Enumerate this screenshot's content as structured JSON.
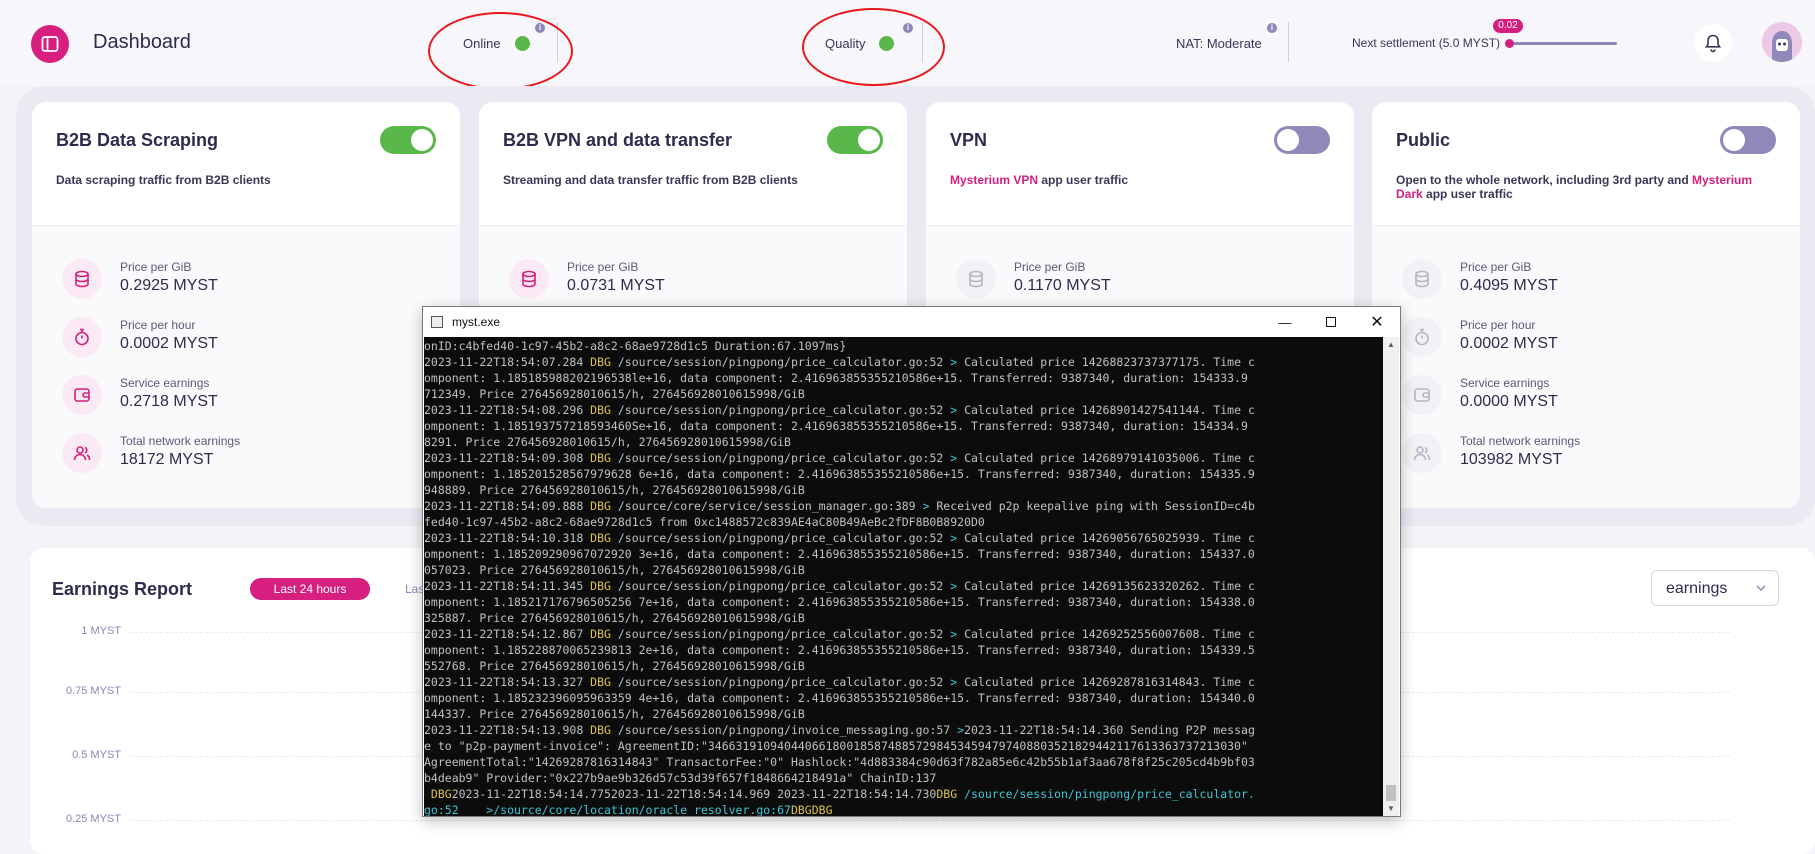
{
  "header": {
    "title": "Dashboard",
    "online_label": "Online",
    "quality_label": "Quality",
    "nat_label": "NAT:",
    "nat_value": "Moderate",
    "settlement_label": "Next settlement (5.0 MYST)",
    "settlement_value": "0.02"
  },
  "cards": [
    {
      "title": "B2B Data Scraping",
      "desc_pre": "Data scraping traffic from B2B clients",
      "toggle_on": true,
      "price_gib_label": "Price per GiB",
      "price_gib": "0.2925 MYST",
      "price_hour_label": "Price per hour",
      "price_hour": "0.0002 MYST",
      "service_label": "Service earnings",
      "service": "0.2718 MYST",
      "total_label": "Total network earnings",
      "total": "18172 MYST"
    },
    {
      "title": "B2B VPN and data transfer",
      "desc_pre": "Streaming and data transfer traffic from B2B clients",
      "toggle_on": true,
      "price_gib_label": "Price per GiB",
      "price_gib": "0.0731 MYST"
    },
    {
      "title": "VPN",
      "desc_link": "Mysterium VPN",
      "desc_post": "app user traffic",
      "toggle_on": false,
      "price_gib_label": "Price per GiB",
      "price_gib": "0.1170 MYST"
    },
    {
      "title": "Public",
      "desc_pre": "Open to the whole network, including 3rd party and",
      "desc_link": "Mysterium Dark",
      "desc_post": "app user traffic",
      "toggle_on": false,
      "price_gib_label": "Price per GiB",
      "price_gib": "0.4095 MYST",
      "price_hour_label": "Price per hour",
      "price_hour": "0.0002 MYST",
      "service_label": "Service earnings",
      "service": "0.0000 MYST",
      "total_label": "Total network earnings",
      "total": "103982 MYST"
    }
  ],
  "earnings": {
    "title": "Earnings Report",
    "tab_active": "Last 24 hours",
    "tab_next": "Las",
    "select_value": "earnings",
    "yticks": [
      "1 MYST",
      "0.75 MYST",
      "0.5 MYST",
      "0.25 MYST"
    ]
  },
  "console": {
    "title": "myst.exe",
    "lines": [
      [
        [
          "",
          "onID:c4bfed40-1c97-45b2-a8c2-68ae9728d1c5 Duration:67.1097ms}"
        ]
      ],
      [
        [
          "",
          "2023-11-22T18:54:07.284 "
        ],
        [
          "y",
          "DBG"
        ],
        [
          "",
          " /source/session/pingpong/price_calculator.go:52 "
        ],
        [
          "c",
          ">"
        ],
        [
          "",
          " Calculated price 14268823737377175. Time c"
        ]
      ],
      [
        [
          "",
          "omponent: 1.185185988202196538le+16, data component: 2.416963855355210586e+15. Transferred: 9387340, duration: 154333.9"
        ]
      ],
      [
        [
          "",
          "712349. Price 276456928010615/h, 276456928010615998/GiB"
        ]
      ],
      [
        [
          "",
          "2023-11-22T18:54:08.296 "
        ],
        [
          "y",
          "DBG"
        ],
        [
          "",
          " /source/session/pingpong/price_calculator.go:52 "
        ],
        [
          "c",
          ">"
        ],
        [
          "",
          " Calculated price 14268901427541144. Time c"
        ]
      ],
      [
        [
          "",
          "omponent: 1.185193757218593460Se+16, data component: 2.416963855355210586e+15. Transferred: 9387340, duration: 154334.9"
        ]
      ],
      [
        [
          "",
          "8291. Price 276456928010615/h, 276456928010615998/GiB"
        ]
      ],
      [
        [
          "",
          "2023-11-22T18:54:09.308 "
        ],
        [
          "y",
          "DBG"
        ],
        [
          "",
          " /source/session/pingpong/price_calculator.go:52 "
        ],
        [
          "c",
          ">"
        ],
        [
          "",
          " Calculated price 14268979141035006. Time c"
        ]
      ],
      [
        [
          "",
          "omponent: 1.185201528567979628 6e+16, data component: 2.416963855355210586e+15. Transferred: 9387340, duration: 154335.9"
        ]
      ],
      [
        [
          "",
          "948889. Price 276456928010615/h, 276456928010615998/GiB"
        ]
      ],
      [
        [
          "",
          "2023-11-22T18:54:09.888 "
        ],
        [
          "y",
          "DBG"
        ],
        [
          "",
          " /source/core/service/session_manager.go:389 "
        ],
        [
          "c",
          ">"
        ],
        [
          "",
          " Received p2p keepalive ping with SessionID=c4b"
        ]
      ],
      [
        [
          "",
          "fed40-1c97-45b2-a8c2-68ae9728d1c5 from 0xc1488572c839AE4aC80B49AeBc2fDF8B0B8920D0"
        ]
      ],
      [
        [
          "",
          "2023-11-22T18:54:10.318 "
        ],
        [
          "y",
          "DBG"
        ],
        [
          "",
          " /source/session/pingpong/price_calculator.go:52 "
        ],
        [
          "c",
          ">"
        ],
        [
          "",
          " Calculated price 14269056765025939. Time c"
        ]
      ],
      [
        [
          "",
          "omponent: 1.185209290967072920 3e+16, data component: 2.416963855355210586e+15. Transferred: 9387340, duration: 154337.0"
        ]
      ],
      [
        [
          "",
          "057023. Price 276456928010615/h, 276456928010615998/GiB"
        ]
      ],
      [
        [
          "",
          "2023-11-22T18:54:11.345 "
        ],
        [
          "y",
          "DBG"
        ],
        [
          "",
          " /source/session/pingpong/price_calculator.go:52 "
        ],
        [
          "c",
          ">"
        ],
        [
          "",
          " Calculated price 14269135623320262. Time c"
        ]
      ],
      [
        [
          "",
          "omponent: 1.185217176796505256 7e+16, data component: 2.416963855355210586e+15. Transferred: 9387340, duration: 154338.0"
        ]
      ],
      [
        [
          "",
          "325887. Price 276456928010615/h, 276456928010615998/GiB"
        ]
      ],
      [
        [
          "",
          "2023-11-22T18:54:12.867 "
        ],
        [
          "y",
          "DBG"
        ],
        [
          "",
          " /source/session/pingpong/price_calculator.go:52 "
        ],
        [
          "c",
          ">"
        ],
        [
          "",
          " Calculated price 14269252556007608. Time c"
        ]
      ],
      [
        [
          "",
          "omponent: 1.185228870065239813 2e+16, data component: 2.416963855355210586e+15. Transferred: 9387340, duration: 154339.5"
        ]
      ],
      [
        [
          "",
          "552768. Price 276456928010615/h, 276456928010615998/GiB"
        ]
      ],
      [
        [
          "",
          "2023-11-22T18:54:13.327 "
        ],
        [
          "y",
          "DBG"
        ],
        [
          "",
          " /source/session/pingpong/price_calculator.go:52 "
        ],
        [
          "c",
          ">"
        ],
        [
          "",
          " Calculated price 14269287816314843. Time c"
        ]
      ],
      [
        [
          "",
          "omponent: 1.185232396095963359 4e+16, data component: 2.416963855355210586e+15. Transferred: 9387340, duration: 154340.0"
        ]
      ],
      [
        [
          "",
          "144337. Price 276456928010615/h, 276456928010615998/GiB"
        ]
      ],
      [
        [
          "",
          "2023-11-22T18:54:13.908 "
        ],
        [
          "y",
          "DBG"
        ],
        [
          "",
          " /source/session/pingpong/invoice_messaging.go:57 "
        ],
        [
          "c",
          ">"
        ],
        [
          "",
          "2023-11-22T18:54:14.360 Sending P2P messag"
        ]
      ],
      [
        [
          "",
          "e to \"p2p-payment-invoice\": AgreementID:\"34663191094044066180018587488572984534594797408803521829442117613363737213030\""
        ]
      ],
      [
        [
          "",
          "AgreementTotal:\"14269287816314843\" TransactorFee:\"0\" Hashlock:\"4d883384c90d63f782a85e6c42b55b1af3aa678f8f25c205cd4b9bf03"
        ]
      ],
      [
        [
          "",
          "b4deab9\" Provider:\"0x227b9ae9b326d57c53d39f657f1848664218491a\" ChainID:137"
        ]
      ],
      [
        [
          "y",
          " DBG"
        ],
        [
          "",
          "2023-11-22T18:54:14.7752023-11-22T18:54:14.969 2023-11-22T18:54:14.730"
        ],
        [
          "y",
          "DBG"
        ],
        [
          "c",
          " /source/session/pingpong/price_calculator."
        ]
      ],
      [
        [
          "c",
          "go:52    >/source/core/location/oracle_resolver.go:67"
        ],
        [
          "y",
          "DBGDBG"
        ],
        [
          "",
          "_"
        ]
      ]
    ]
  },
  "colors": {
    "accent": "#d61f7f",
    "online": "#5ab84a",
    "toggle_off": "#8e89b8",
    "annotation": "#e8181c"
  }
}
